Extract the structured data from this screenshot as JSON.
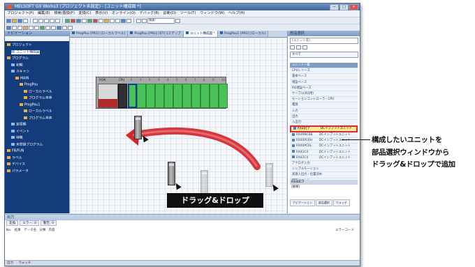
{
  "window": {
    "title": "MELSOFT GX Works3 (プロジェクト未設定) - [ユニット構成図 *]",
    "controls": [
      "—",
      "□",
      "×"
    ]
  },
  "menubar": [
    "プロジェクト(P)",
    "編集(E)",
    "検索/置換(F)",
    "変換(C)",
    "表示(V)",
    "オンライン(O)",
    "デバッグ(B)",
    "診断(D)",
    "ツール(T)",
    "ウィンドウ(W)",
    "ヘルプ(H)"
  ],
  "toolbar": {
    "search_placeholder": "検索:"
  },
  "navigation": {
    "title": "ナビゲーション",
    "items": [
      {
        "label": "プロジェクト",
        "level": 0
      },
      {
        "label": "ユニット構成図",
        "level": 1,
        "selected": true
      },
      {
        "label": "プログラム",
        "level": 0
      },
      {
        "label": "初期",
        "level": 1
      },
      {
        "label": "スキャン",
        "level": 1
      },
      {
        "label": "MAIN",
        "level": 2
      },
      {
        "label": "ProgPou",
        "level": 3
      },
      {
        "label": "ローカルラベル",
        "level": 4
      },
      {
        "label": "プログラム本体",
        "level": 4
      },
      {
        "label": "ProgPou1",
        "level": 3
      },
      {
        "label": "ローカルラベル",
        "level": 4
      },
      {
        "label": "プログラム本体",
        "level": 4
      },
      {
        "label": "定周期",
        "level": 1
      },
      {
        "label": "イベント",
        "level": 1
      },
      {
        "label": "待機",
        "level": 1
      },
      {
        "label": "未登録プログラム",
        "level": 1
      },
      {
        "label": "FB/FUN",
        "level": 0
      },
      {
        "label": "ラベル",
        "level": 0
      },
      {
        "label": "デバイス",
        "level": 0
      },
      {
        "label": "パラメータ",
        "level": 0
      }
    ]
  },
  "editor_tabs": [
    {
      "label": "ProgPou [PRG] [ローカルラベル]",
      "active": false
    },
    {
      "label": "ProgPou [PRG] [ST] 1ステップ",
      "active": false
    },
    {
      "label": "ユニット構成図 *",
      "active": true
    },
    {
      "label": "ProgPou1 [PRG] [ローカル]",
      "active": false
    }
  ],
  "canvas": {
    "base_labels": {
      "power": "POW",
      "cpu": "CPU"
    },
    "slot_numbers": [
      "0",
      "1",
      "2",
      "3",
      "4",
      "5",
      "6",
      "7",
      "8",
      "9",
      "10"
    ],
    "callout": "ドラッグ&ドロップ"
  },
  "parts_panel": {
    "title": "部品選択",
    "search_placeholder": "(ユニット名)",
    "category_value": "すべて",
    "items": [
      {
        "name": "ユニット一覧",
        "desc": "",
        "header": true
      },
      {
        "name": "CPUシリーズ",
        "desc": ""
      },
      {
        "name": "基本ベース",
        "desc": ""
      },
      {
        "name": "増設ベース",
        "desc": ""
      },
      {
        "name": "RQ増設ベース",
        "desc": ""
      },
      {
        "name": "ケーブル(RQ用)",
        "desc": ""
      },
      {
        "name": "モーションコントローラ・CPU",
        "desc": ""
      },
      {
        "name": "電源",
        "desc": ""
      },
      {
        "name": "入力",
        "desc": ""
      },
      {
        "name": "出力",
        "desc": ""
      },
      {
        "name": "入出力",
        "desc": ""
      },
      {
        "name": "RX40C7",
        "desc": "DCインプットユニット",
        "highlight": true
      },
      {
        "name": "RX40NC6B",
        "desc": "DCインプットユニット"
      },
      {
        "name": "RX40PC6H",
        "desc": "DCインプットユニット"
      },
      {
        "name": "RX40PC6L",
        "desc": "DCインプットユニット"
      },
      {
        "name": "RX41C4",
        "desc": "DCインプットユニット"
      },
      {
        "name": "RX42C4",
        "desc": "DCインプットユニット"
      },
      {
        "name": "アナログ入力",
        "desc": ""
      },
      {
        "name": "シンプルモーション",
        "desc": ""
      },
      {
        "name": "高速入出力・位置決め",
        "desc": ""
      },
      {
        "name": "情報ユニット",
        "desc": ""
      }
    ],
    "info_label": "RX40C7",
    "info_sub": "[概要]",
    "bottom_tabs": [
      "ナビゲーション",
      "部品選択",
      "ウォッチ"
    ]
  },
  "output_panel": {
    "title": "出力",
    "tabs": [
      "変換",
      "エラー: 0",
      "警告: 0"
    ],
    "columns": [
      "No.",
      "結果",
      "データ名",
      "分類",
      "内容"
    ],
    "right_label": "エラーコード"
  },
  "statusbar": {
    "left": "出力",
    "right": "ウォッチ"
  },
  "annotation": {
    "lines": [
      "構成したいユニットを",
      "部品選択ウィンドウから",
      "ドラッグ&ドロップで追加"
    ]
  },
  "colors": {
    "accent": "#143c7a",
    "slot_green": "#49c25a",
    "arrow_red": "#d4252a",
    "highlight": "#e02a2a"
  }
}
